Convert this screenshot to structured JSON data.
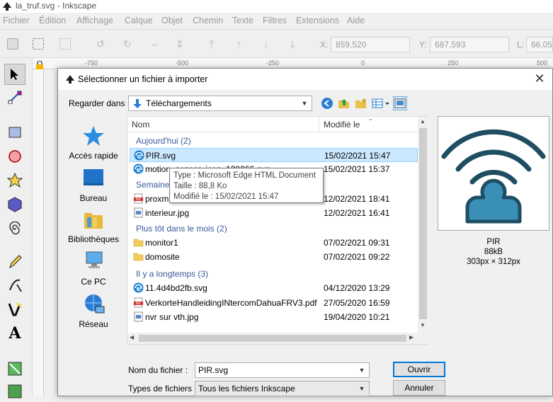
{
  "app": {
    "title": "la_truf.svg - Inkscape",
    "menu": [
      "Fichier",
      "Édition",
      "Affichage",
      "Calque",
      "Objet",
      "Chemin",
      "Texte",
      "Filtres",
      "Extensions",
      "Aide"
    ],
    "coords": {
      "x_label": "X:",
      "x_value": "859,520",
      "y_label": "Y:",
      "y_value": "687,593",
      "l_label": "L:",
      "l_value": "66,05"
    },
    "ruler": [
      "-750",
      "-500",
      "-250",
      "0",
      "250",
      "500"
    ]
  },
  "dialog": {
    "title": "Sélectionner un fichier à importer",
    "look_in_label": "Regarder dans :",
    "look_in_value": "Téléchargements",
    "places": [
      "Accès rapide",
      "Bureau",
      "Bibliothèques",
      "Ce PC",
      "Réseau"
    ],
    "columns": {
      "name": "Nom",
      "modified": "Modifié le"
    },
    "groups": [
      {
        "label": "Aujourd'hui (2)"
      },
      {
        "label": "Semaine"
      },
      {
        "label": "Plus tôt dans le mois (2)"
      },
      {
        "label": "Il y a longtemps (3)"
      }
    ],
    "files": [
      {
        "name": "PIR.svg",
        "date": "15/02/2021 15:47",
        "icon": "edge-icon",
        "selected": true
      },
      {
        "name": "motion_sensor_icon_128266.svg",
        "date": "15/02/2021 15:37",
        "icon": "edge-icon"
      },
      {
        "name": "proxm",
        "date": "12/02/2021 18:41",
        "icon": "pdf-icon"
      },
      {
        "name": "interieur.jpg",
        "date": "12/02/2021 16:41",
        "icon": "image-icon"
      },
      {
        "name": "monitor1",
        "date": "07/02/2021 09:31",
        "icon": "folder-icon"
      },
      {
        "name": "domosite",
        "date": "07/02/2021 09:22",
        "icon": "folder-icon"
      },
      {
        "name": "11.4d4bd2fb.svg",
        "date": "04/12/2020 13:29",
        "icon": "edge-icon"
      },
      {
        "name": "VerkorteHandleidingINtercomDahuaFRV3.pdf",
        "date": "27/05/2020 16:59",
        "icon": "pdf-icon"
      },
      {
        "name": "nvr sur vth.jpg",
        "date": "19/04/2020 10:21",
        "icon": "image-icon"
      }
    ],
    "tooltip": {
      "type": "Type : Microsoft Edge HTML Document",
      "size": "Taille : 88,8 Ko",
      "modified": "Modifié le : 15/02/2021 15:47"
    },
    "preview": {
      "name": "PIR",
      "size": "88kB",
      "dims": "303px × 312px"
    },
    "filename_label": "Nom du fichier :",
    "filename_value": "PIR.svg",
    "filetype_label": "Types de fichiers :",
    "filetype_value": "Tous les fichiers Inkscape",
    "open_label": "Ouvrir",
    "cancel_label": "Annuler"
  },
  "colors": {
    "accent": "#0078d7",
    "selection": "#cce8ff",
    "group_text": "#3a5a9b",
    "preview_icon": "#1f4e63",
    "preview_fill": "#3a8fb7"
  }
}
